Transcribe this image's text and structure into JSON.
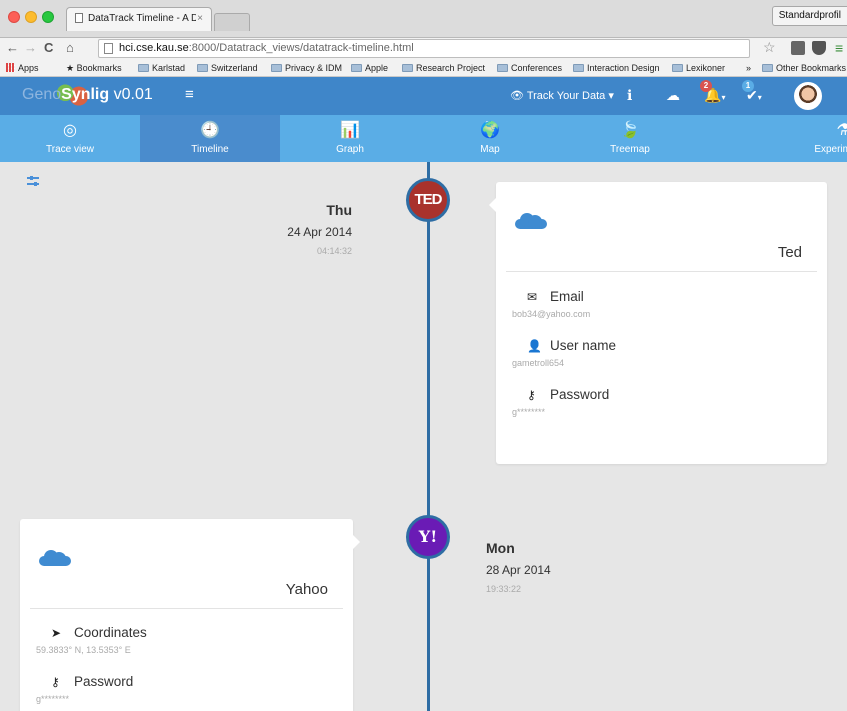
{
  "browser": {
    "tab_title": "DataTrack Timeline - A Dat",
    "tab_close": "×",
    "profile_label": "Standardprofil",
    "url_host": "hci.cse.kau.se",
    "url_path": ":8000/Datatrack_views/datatrack-timeline.html",
    "bookmarks": [
      {
        "label": "Apps"
      },
      {
        "label": "Bookmarks"
      },
      {
        "label": "Karlstad"
      },
      {
        "label": "Switzerland"
      },
      {
        "label": "Privacy & IDM"
      },
      {
        "label": "Apple"
      },
      {
        "label": "Research Project"
      },
      {
        "label": "Conferences"
      },
      {
        "label": "Interaction Design"
      },
      {
        "label": "Lexikoner"
      },
      {
        "label": "»"
      },
      {
        "label": "Other Bookmarks"
      }
    ]
  },
  "navbar": {
    "brand_prefix": "Geno",
    "brand_name": "Synlig",
    "brand_version": " v0.01",
    "menu_icon": "≡",
    "track_label": "👁 Track Your Data ▾",
    "notification_count": "2",
    "tasks_count": "1",
    "colors": {
      "navbar": "#3f86c9",
      "badge_red": "#d9534f",
      "badge_blue": "#5aade6"
    }
  },
  "subnav": {
    "items": [
      {
        "label": "Trace view",
        "icon": "target-icon",
        "glyph": "◎"
      },
      {
        "label": "Timeline",
        "icon": "clock-icon",
        "glyph": "🕘",
        "active": true
      },
      {
        "label": "Graph",
        "icon": "bar-chart-icon",
        "glyph": "📊"
      },
      {
        "label": "Map",
        "icon": "globe-icon",
        "glyph": "🌍"
      },
      {
        "label": "Treemap",
        "icon": "leaf-icon",
        "glyph": "🍃"
      },
      {
        "label": "Experimental",
        "icon": "flask-icon",
        "glyph": "⚗"
      }
    ]
  },
  "timeline": {
    "events": [
      {
        "service": "Ted",
        "node_text": "TED",
        "day": "Thu",
        "date": "24 Apr 2014",
        "time": "04:14:32",
        "fields": [
          {
            "label": "Email",
            "icon": "envelope-icon",
            "glyph": "✉",
            "value": "bob34@yahoo.com"
          },
          {
            "label": "User name",
            "icon": "user-icon",
            "glyph": "👤",
            "value": "gametroll654"
          },
          {
            "label": "Password",
            "icon": "key-icon",
            "glyph": "⚷",
            "value": "g********"
          }
        ]
      },
      {
        "service": "Yahoo",
        "node_text": "Y!",
        "day": "Mon",
        "date": "28 Apr 2014",
        "time": "19:33:22",
        "fields": [
          {
            "label": "Coordinates",
            "icon": "location-arrow-icon",
            "glyph": "➤",
            "value": "59.3833° N, 13.5353° E"
          },
          {
            "label": "Password",
            "icon": "key-icon",
            "glyph": "⚷",
            "value": "g********"
          }
        ]
      }
    ]
  }
}
